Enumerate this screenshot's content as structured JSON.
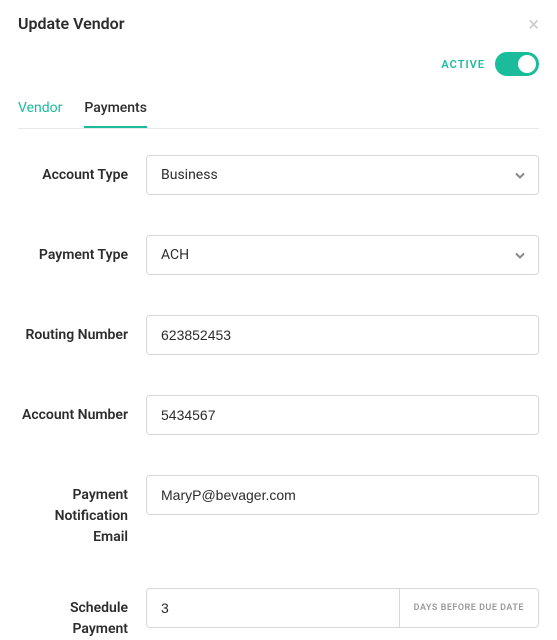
{
  "header": {
    "title": "Update Vendor"
  },
  "status": {
    "label": "ACTIVE",
    "on": true
  },
  "tabs": [
    {
      "label": "Vendor",
      "active": false
    },
    {
      "label": "Payments",
      "active": true
    }
  ],
  "form": {
    "accountType": {
      "label": "Account Type",
      "value": "Business"
    },
    "paymentType": {
      "label": "Payment Type",
      "value": "ACH"
    },
    "routingNumber": {
      "label": "Routing Number",
      "value": "623852453"
    },
    "accountNumber": {
      "label": "Account Number",
      "value": "5434567"
    },
    "paymentNotificationEmail": {
      "label": "Payment Notification Email",
      "value": "MaryP@bevager.com"
    },
    "schedulePayment": {
      "label": "Schedule Payment",
      "value": "3",
      "suffix": "DAYS BEFORE DUE DATE"
    }
  }
}
